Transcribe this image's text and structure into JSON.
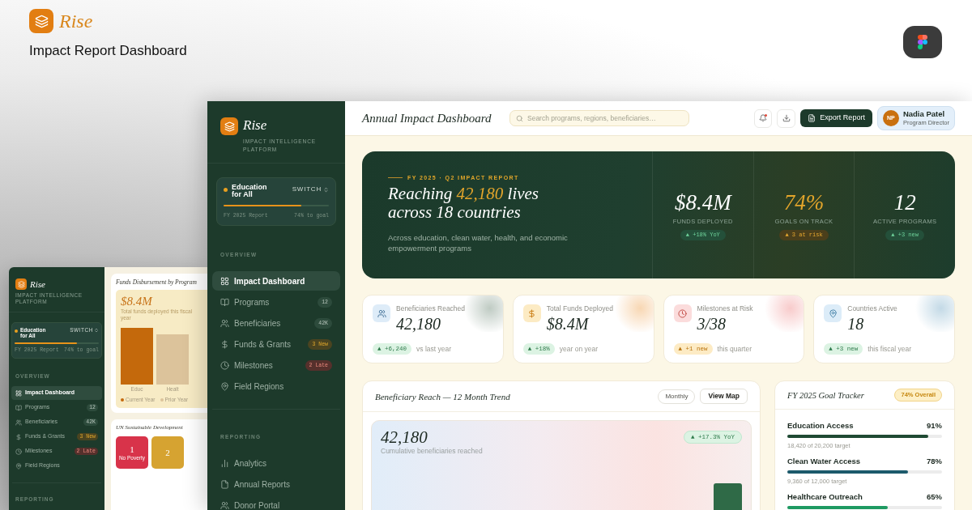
{
  "brand": {
    "name": "Rise",
    "title": "Impact Report Dashboard"
  },
  "background_screen": {
    "sidebar": {
      "logo": "Rise",
      "tagline": "IMPACT INTELLIGENCE PLATFORM",
      "program": {
        "name": "Education for All",
        "switch": "SWITCH",
        "level": 0.74,
        "report": "FY 2025 Report",
        "progress": "74% to goal"
      },
      "sections": [
        {
          "title": "OVERVIEW",
          "items": [
            {
              "label": "Impact Dashboard",
              "selected": true
            },
            {
              "label": "Programs",
              "selected": false,
              "badge": {
                "text": "12",
                "kind": "neutral"
              }
            },
            {
              "label": "Beneficiaries",
              "selected": false,
              "badge": {
                "text": "42K",
                "kind": "neutral"
              }
            },
            {
              "label": "Funds & Grants",
              "selected": false,
              "badge": {
                "text": "3 New",
                "kind": "warning"
              }
            },
            {
              "label": "Milestones",
              "selected": false,
              "badge": {
                "text": "2 Late",
                "kind": "danger"
              }
            },
            {
              "label": "Field Regions",
              "selected": false
            }
          ]
        },
        {
          "title": "REPORTING"
        }
      ]
    },
    "funds_card": {
      "title": "Funds Disbursement by Program",
      "value": "$8.4M",
      "caption": "Total funds deployed this fiscal year",
      "bar_labels": [
        "Educ",
        "Healt"
      ],
      "legend": [
        {
          "label": "Current Year",
          "color": "#c4690c"
        },
        {
          "label": "Prior Year",
          "color": "#dcc39b"
        }
      ]
    },
    "sdg_card": {
      "title": "UN Sustainable Development",
      "goals": [
        {
          "number": "1",
          "name": "No Poverty",
          "color": "#d8334a"
        },
        {
          "number": "2",
          "color": "#d6a331"
        }
      ]
    }
  },
  "sidebar": {
    "logo": "Rise",
    "tagline": "IMPACT INTELLIGENCE PLATFORM",
    "program": {
      "name": "Education for All",
      "switch": "SWITCH",
      "level": 0.74,
      "report": "FY 2025 Report",
      "progress": "74% to goal"
    },
    "sections": [
      {
        "title": "OVERVIEW",
        "items": [
          {
            "label": "Impact Dashboard",
            "selected": true
          },
          {
            "label": "Programs",
            "selected": false,
            "badge": {
              "text": "12",
              "kind": "neutral"
            }
          },
          {
            "label": "Beneficiaries",
            "selected": false,
            "badge": {
              "text": "42K",
              "kind": "neutral"
            }
          },
          {
            "label": "Funds & Grants",
            "selected": false,
            "badge": {
              "text": "3 New",
              "kind": "warning"
            }
          },
          {
            "label": "Milestones",
            "selected": false,
            "badge": {
              "text": "2 Late",
              "kind": "danger"
            }
          },
          {
            "label": "Field Regions",
            "selected": false
          }
        ]
      },
      {
        "title": "REPORTING",
        "items": [
          {
            "label": "Analytics",
            "selected": false
          },
          {
            "label": "Annual Reports",
            "selected": false
          },
          {
            "label": "Donor Portal",
            "selected": false
          }
        ]
      }
    ]
  },
  "header": {
    "title": "Annual Impact Dashboard",
    "search": {
      "placeholder": "Search programs, regions, beneficiaries…"
    },
    "notifications": {
      "unread": true
    },
    "export_label": "Export Report",
    "user": {
      "initials": "NP",
      "name": "Nadia Patel",
      "role": "Program Director"
    }
  },
  "hero": {
    "eyebrow": "FY 2025 · Q2 IMPACT REPORT",
    "headline": [
      {
        "text": "Reaching ",
        "highlight": false
      },
      {
        "text": "42,180",
        "highlight": true
      },
      {
        "text": " lives across 18 countries",
        "highlight": false
      }
    ],
    "subtitle": "Across education, clean water, health, and economic empowerment programs",
    "metrics": [
      {
        "value": "$8.4M",
        "label": "FUNDS DEPLOYED",
        "delta": {
          "text": "▲ +18% YoY",
          "kind": "positive"
        },
        "highlight": false
      },
      {
        "value": "74%",
        "label": "GOALS ON TRACK",
        "delta": {
          "text": "▲ 3 at risk",
          "kind": "warning"
        },
        "highlight": true
      },
      {
        "value": "12",
        "label": "ACTIVE PROGRAMS",
        "delta": {
          "text": "▲ +3 new",
          "kind": "positive"
        },
        "highlight": false
      }
    ]
  },
  "stats": [
    {
      "label": "Beneficiaries Reached",
      "value": "42,180",
      "delta": {
        "text": "▲ +6,240",
        "kind": "positive"
      },
      "note": "vs last year"
    },
    {
      "label": "Total Funds Deployed",
      "value": "$8.4M",
      "delta": {
        "text": "▲ +18%",
        "kind": "positive"
      },
      "note": "year on year"
    },
    {
      "label": "Milestones at Risk",
      "value": "3/38",
      "delta": {
        "text": "▲ +1 new",
        "kind": "warning"
      },
      "note": "this quarter"
    },
    {
      "label": "Countries Active",
      "value": "18",
      "delta": {
        "text": "▲ +3 new",
        "kind": "positive"
      },
      "note": "this fiscal year"
    }
  ],
  "trend": {
    "title": "Beneficiary Reach — 12 Month Trend",
    "buttons": [
      {
        "label": "Monthly",
        "kind": "pill"
      },
      {
        "label": "View Map",
        "kind": "outline"
      }
    ],
    "value": "42,180",
    "caption": "Cumulative beneficiaries reached",
    "delta": {
      "text": "▲ +17.3% YoY",
      "kind": "positive"
    }
  },
  "goals": {
    "title": "FY 2025 Goal Tracker",
    "badge": "74% Overall",
    "items": [
      {
        "name": "Education Access",
        "percent": "91%",
        "level": 0.91,
        "color": "#1f4a33",
        "target": "18,420 of 20,200 target"
      },
      {
        "name": "Clean Water Access",
        "percent": "78%",
        "level": 0.78,
        "color": "#1c5a6b",
        "target": "9,360 of 12,000 target"
      },
      {
        "name": "Healthcare Outreach",
        "percent": "65%",
        "level": 0.65,
        "color": "#1f9a62"
      }
    ]
  }
}
